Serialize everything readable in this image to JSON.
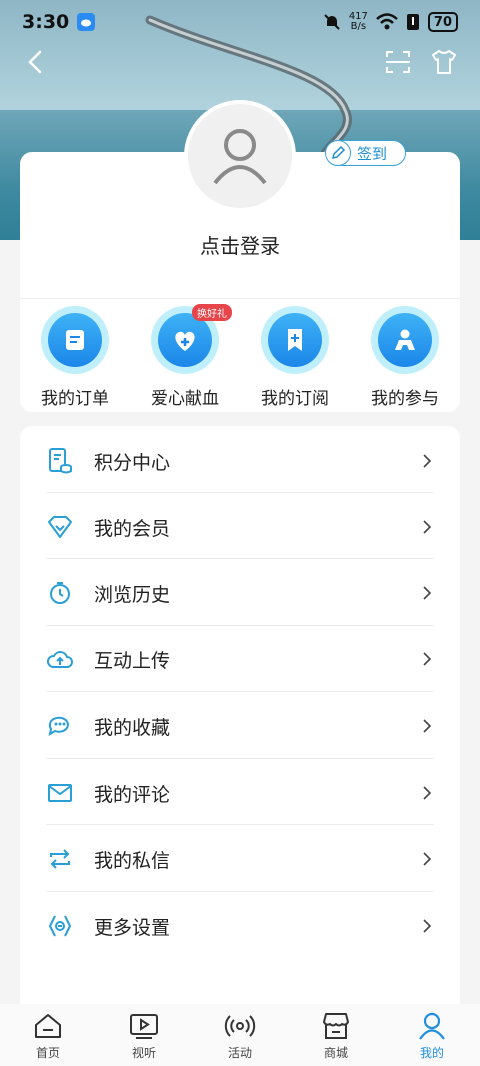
{
  "status_bar": {
    "time": "3:30",
    "net_speed_value": "417",
    "net_speed_unit": "B/s",
    "battery": "70"
  },
  "profile": {
    "login_prompt": "点击登录",
    "signin_label": "签到"
  },
  "quick_actions": [
    {
      "label": "我的订单",
      "icon": "order-icon"
    },
    {
      "label": "爱心献血",
      "icon": "blood-donation-icon",
      "badge": "换好礼"
    },
    {
      "label": "我的订阅",
      "icon": "bookmark-icon"
    },
    {
      "label": "我的参与",
      "icon": "participation-icon"
    }
  ],
  "menu": [
    {
      "label": "积分中心",
      "icon": "points-icon"
    },
    {
      "label": "我的会员",
      "icon": "diamond-icon"
    },
    {
      "label": "浏览历史",
      "icon": "history-icon"
    },
    {
      "label": "互动上传",
      "icon": "upload-cloud-icon"
    },
    {
      "label": "我的收藏",
      "icon": "chat-favorite-icon"
    },
    {
      "label": "我的评论",
      "icon": "mail-icon"
    },
    {
      "label": "我的私信",
      "icon": "repeat-icon"
    },
    {
      "label": "更多设置",
      "icon": "settings-icon"
    }
  ],
  "bottom_nav": [
    {
      "label": "首页",
      "icon": "home-icon"
    },
    {
      "label": "视听",
      "icon": "video-icon"
    },
    {
      "label": "活动",
      "icon": "broadcast-icon"
    },
    {
      "label": "商城",
      "icon": "store-icon"
    },
    {
      "label": "我的",
      "icon": "profile-icon",
      "active": true
    }
  ],
  "colors": {
    "accent": "#1f8fe0",
    "icon_blue": "#2a9fd6",
    "badge_red": "#e8454b"
  }
}
